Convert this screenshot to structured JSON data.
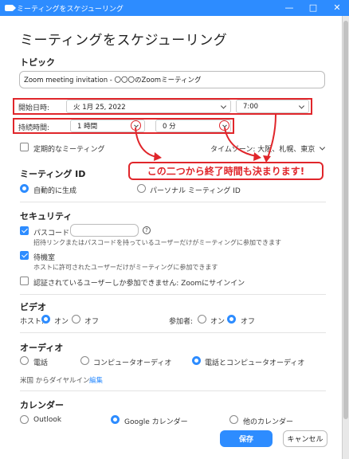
{
  "window": {
    "title": "ミーティングをスケジューリング",
    "minimize": "—",
    "maximize": "□",
    "close": "✕"
  },
  "page_title": "ミーティングをスケジューリング",
  "topic": {
    "heading": "トピック",
    "value": "Zoom meeting invitation - 〇〇〇のZoomミーティング"
  },
  "start": {
    "label": "開始日時:",
    "date": "火  1月  25, 2022",
    "time": "7:00"
  },
  "duration": {
    "label": "持続時間:",
    "hours": "1 時間",
    "minutes": "0 分"
  },
  "recurring": {
    "label": "定期的なミーティング",
    "checked": false
  },
  "timezone": {
    "label": "タイムゾーン: 大阪、札幌、東京"
  },
  "callout": {
    "text": "この二つから終了時間も決まります!"
  },
  "meeting_id": {
    "heading": "ミーティング ID",
    "options": [
      {
        "label": "自動的に生成",
        "selected": true
      },
      {
        "label": "パーソナル ミーティング ID",
        "selected": false
      }
    ]
  },
  "security": {
    "heading": "セキュリティ",
    "passcode": {
      "label": "パスコード",
      "value": "",
      "checked": true,
      "hint": "招待リンクまたはパスコードを持っているユーザーだけがミーティングに参加できます"
    },
    "waiting_room": {
      "label": "待機室",
      "checked": true,
      "hint": "ホストに許可されたユーザーだけがミーティングに参加できます"
    },
    "auth": {
      "label": "認証されているユーザーしか参加できません: Zoomにサインイン",
      "checked": false
    }
  },
  "video": {
    "heading": "ビデオ",
    "host_label": "ホスト:",
    "participant_label": "参加者:",
    "on": "オン",
    "off": "オフ",
    "host_on": true,
    "participant_on": false
  },
  "audio": {
    "heading": "オーディオ",
    "options": [
      {
        "label": "電話",
        "selected": false
      },
      {
        "label": "コンピュータオーディオ",
        "selected": false
      },
      {
        "label": "電話とコンピュータオーディオ",
        "selected": true
      }
    ],
    "dial_in": "米国 からダイヤルイン",
    "edit": "編集"
  },
  "calendar": {
    "heading": "カレンダー",
    "options": [
      {
        "label": "Outlook",
        "selected": false
      },
      {
        "label": "Google カレンダー",
        "selected": true
      },
      {
        "label": "他のカレンダー",
        "selected": false
      }
    ]
  },
  "buttons": {
    "save": "保存",
    "cancel": "キャンセル"
  },
  "colors": {
    "accent": "#2d8cff",
    "annotation": "#e0262b"
  }
}
